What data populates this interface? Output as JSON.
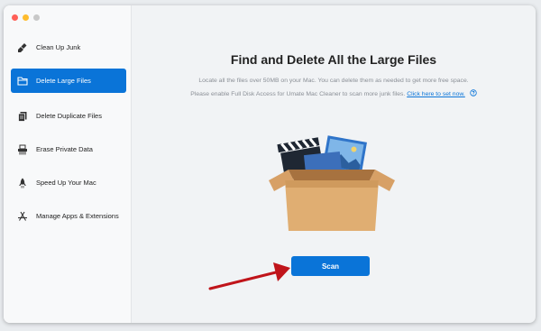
{
  "window": {
    "traffic_lights": [
      "#ff5f57",
      "#febc2e",
      "#c8c8c8"
    ]
  },
  "sidebar": {
    "items": [
      {
        "label": "Clean Up Junk",
        "icon": "broom-icon",
        "active": false
      },
      {
        "label": "Delete Large Files",
        "icon": "folder-icon",
        "active": true
      },
      {
        "label": "Delete Duplicate Files",
        "icon": "duplicate-files-icon",
        "active": false
      },
      {
        "label": "Erase Private Data",
        "icon": "shredder-icon",
        "active": false
      },
      {
        "label": "Speed Up Your Mac",
        "icon": "rocket-icon",
        "active": false
      },
      {
        "label": "Manage Apps & Extensions",
        "icon": "app-store-icon",
        "active": false
      }
    ]
  },
  "main": {
    "title": "Find and Delete All the Large Files",
    "description_line1": "Locate all the files over 50MB on your Mac. You can delete them as needed to get more free space.",
    "description_line2_prefix": "Please enable Full Disk Access for Umate Mac Cleaner to scan more junk files.",
    "link_text": "Click here to set now.",
    "help_icon": "question-circle-icon",
    "illustration": "open-box-with-files-icon",
    "scan_label": "Scan"
  },
  "colors": {
    "accent": "#0a74d8",
    "annotation_arrow": "#c0141a"
  }
}
